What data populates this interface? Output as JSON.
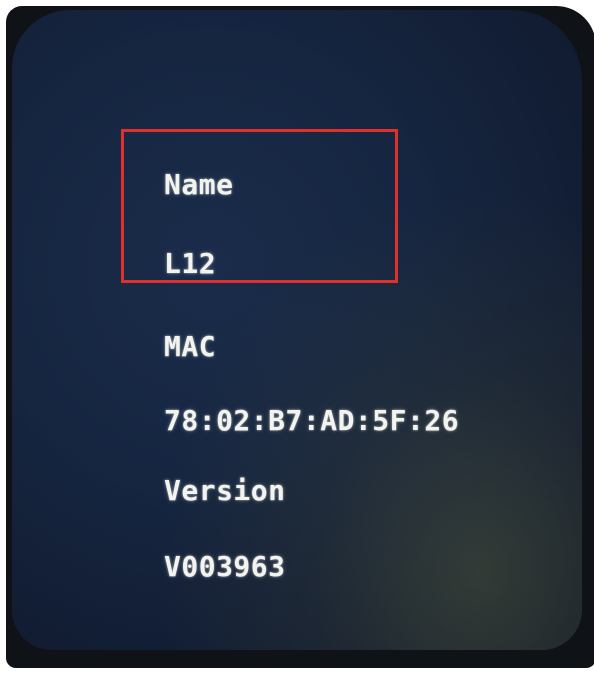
{
  "device_info": {
    "name_label": "Name",
    "name_value": "L12",
    "mac_label": "MAC",
    "mac_value": "78:02:B7:AD:5F:26",
    "version_label": "Version",
    "version_value": "V003963"
  },
  "colors": {
    "screen_background": "#162641",
    "text": "#f4f4ee",
    "highlight": "#e0302c"
  }
}
